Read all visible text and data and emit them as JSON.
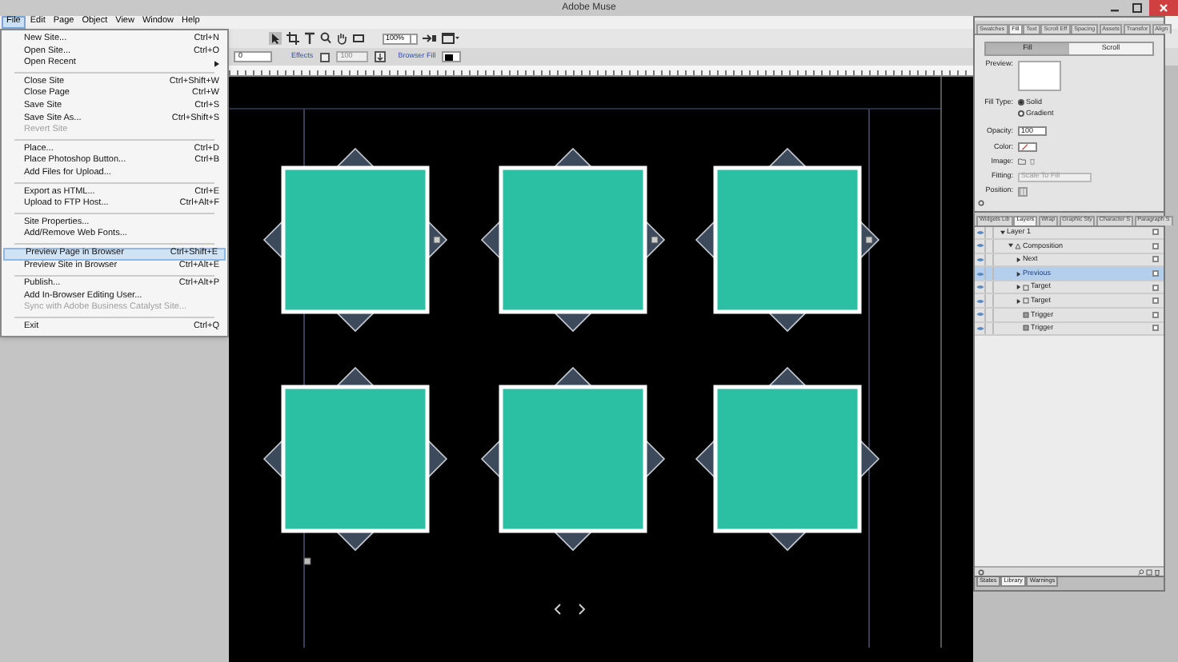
{
  "window": {
    "title": "Adobe Muse"
  },
  "menu_bar": [
    {
      "label": "File",
      "selected": true
    },
    {
      "label": "Edit",
      "selected": false
    },
    {
      "label": "Page",
      "selected": false
    },
    {
      "label": "Object",
      "selected": false
    },
    {
      "label": "View",
      "selected": false
    },
    {
      "label": "Window",
      "selected": false
    },
    {
      "label": "Help",
      "selected": false
    }
  ],
  "file_menu": {
    "groups": [
      [
        {
          "label": "New Site...",
          "shortcut": "Ctrl+N",
          "disabled": false,
          "selected": false,
          "submenu": false
        },
        {
          "label": "Open Site...",
          "shortcut": "Ctrl+O",
          "disabled": false,
          "selected": false,
          "submenu": false
        },
        {
          "label": "Open Recent",
          "disabled": false,
          "selected": false,
          "submenu": true
        }
      ],
      [
        {
          "label": "Close Site",
          "shortcut": "Ctrl+Shift+W",
          "disabled": false,
          "selected": false,
          "submenu": false
        },
        {
          "label": "Close Page",
          "shortcut": "Ctrl+W",
          "disabled": false,
          "selected": false,
          "submenu": false
        },
        {
          "label": "Save Site",
          "shortcut": "Ctrl+S",
          "disabled": false,
          "selected": false,
          "submenu": false
        },
        {
          "label": "Save Site As...",
          "shortcut": "Ctrl+Shift+S",
          "disabled": false,
          "selected": false,
          "submenu": false
        },
        {
          "label": "Revert Site",
          "disabled": true,
          "selected": false,
          "submenu": false
        }
      ],
      [
        {
          "label": "Place...",
          "shortcut": "Ctrl+D",
          "disabled": false,
          "selected": false,
          "submenu": false
        },
        {
          "label": "Place Photoshop Button...",
          "shortcut": "Ctrl+B",
          "disabled": false,
          "selected": false,
          "submenu": false
        },
        {
          "label": "Add Files for Upload...",
          "disabled": false,
          "selected": false,
          "submenu": false
        }
      ],
      [
        {
          "label": "Export as HTML...",
          "shortcut": "Ctrl+E",
          "disabled": false,
          "selected": false,
          "submenu": false
        },
        {
          "label": "Upload to FTP Host...",
          "shortcut": "Ctrl+Alt+F",
          "disabled": false,
          "selected": false,
          "submenu": false
        }
      ],
      [
        {
          "label": "Site Properties...",
          "disabled": false,
          "selected": false,
          "submenu": false
        },
        {
          "label": "Add/Remove Web Fonts...",
          "disabled": false,
          "selected": false,
          "submenu": false
        }
      ],
      [
        {
          "label": "Preview Page in Browser",
          "shortcut": "Ctrl+Shift+E",
          "disabled": false,
          "selected": true,
          "submenu": false
        },
        {
          "label": "Preview Site in Browser",
          "shortcut": "Ctrl+Alt+E",
          "disabled": false,
          "selected": false,
          "submenu": false
        }
      ],
      [
        {
          "label": "Publish...",
          "shortcut": "Ctrl+Alt+P",
          "disabled": false,
          "selected": false,
          "submenu": false
        },
        {
          "label": "Add In-Browser Editing User...",
          "disabled": false,
          "selected": false,
          "submenu": false
        },
        {
          "label": "Sync with Adobe Business Catalyst Site...",
          "disabled": true,
          "selected": false,
          "submenu": false
        }
      ],
      [
        {
          "label": "Exit",
          "shortcut": "Ctrl+Q",
          "disabled": false,
          "selected": false,
          "submenu": false
        }
      ]
    ]
  },
  "toolbar": {
    "zoom": "100%"
  },
  "control_bar": {
    "value_field": "0",
    "effects_link": "Effects",
    "opacity_field": "100",
    "browser_fill_link": "Browser Fill"
  },
  "fill_panel": {
    "tabs": [
      {
        "label": "Swatches",
        "selected": false
      },
      {
        "label": "Fill",
        "selected": true
      },
      {
        "label": "Text",
        "selected": false
      },
      {
        "label": "Scroll Eff",
        "selected": false
      },
      {
        "label": "Spacing",
        "selected": false
      },
      {
        "label": "Assets",
        "selected": false
      },
      {
        "label": "Transfor",
        "selected": false
      },
      {
        "label": "Align",
        "selected": false
      }
    ],
    "modes": [
      {
        "label": "Fill",
        "selected": true
      },
      {
        "label": "Scroll",
        "selected": false
      }
    ],
    "preview_label": "Preview:",
    "fill_type_label": "Fill Type:",
    "fill_types": [
      {
        "label": "Solid",
        "selected": true
      },
      {
        "label": "Gradient",
        "selected": false
      }
    ],
    "opacity_label": "Opacity:",
    "opacity": "100",
    "color_label": "Color:",
    "image_label": "Image:",
    "fitting_label": "Fitting:",
    "fitting": "Scale To Fill",
    "position_label": "Position:"
  },
  "layers_panel": {
    "tabs": [
      {
        "label": "Widgets Lib",
        "selected": false
      },
      {
        "label": "Layers",
        "selected": true
      },
      {
        "label": "Wrap",
        "selected": false
      },
      {
        "label": "Graphic Sty",
        "selected": false
      },
      {
        "label": "Character S",
        "selected": false
      },
      {
        "label": "Paragraph S",
        "selected": false
      }
    ],
    "layers": [
      {
        "label": "Layer 1",
        "expanded": true,
        "selected": false,
        "children": [
          {
            "label": "Composition",
            "kind": "composition",
            "expanded": true,
            "selected": false,
            "children": [
              {
                "label": "Next",
                "expanded": false,
                "selected": false
              },
              {
                "label": "Previous",
                "expanded": false,
                "selected": true
              },
              {
                "label": "Target",
                "kind": "target",
                "expanded": false,
                "selected": false
              },
              {
                "label": "Target",
                "kind": "target",
                "expanded": false,
                "selected": false
              },
              {
                "label": "Trigger",
                "kind": "trigger",
                "selected": false
              },
              {
                "label": "Trigger",
                "kind": "trigger",
                "selected": false
              }
            ]
          }
        ]
      }
    ],
    "bottom_tabs": [
      {
        "label": "States",
        "selected": false
      },
      {
        "label": "Library",
        "selected": true
      },
      {
        "label": "Warnings",
        "selected": false
      }
    ]
  }
}
